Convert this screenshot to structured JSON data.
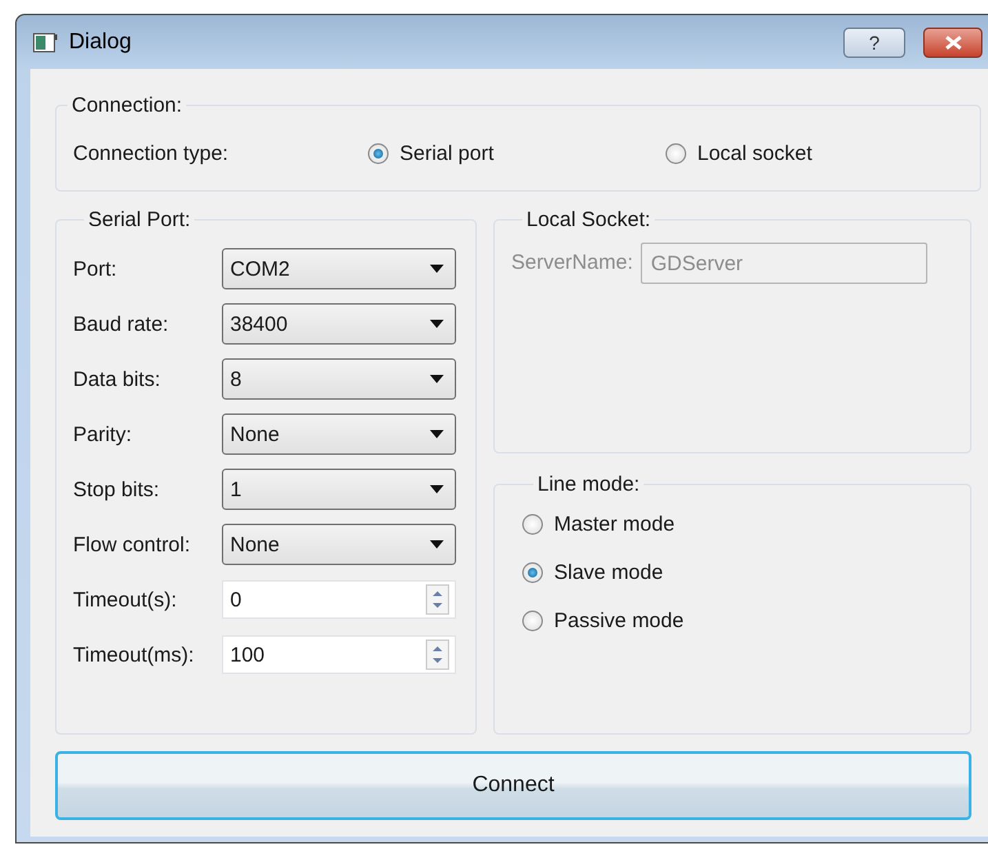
{
  "window": {
    "title": "Dialog",
    "help_button": "?"
  },
  "connection": {
    "title": "Connection:",
    "label": "Connection type:",
    "options": [
      {
        "label": "Serial port",
        "selected": true
      },
      {
        "label": "Local socket",
        "selected": false
      }
    ]
  },
  "serial_port": {
    "title": "Serial Port:",
    "rows": [
      {
        "kind": "combo",
        "label": "Port:",
        "value": "COM2"
      },
      {
        "kind": "combo",
        "label": "Baud rate:",
        "value": "38400"
      },
      {
        "kind": "combo",
        "label": "Data bits:",
        "value": "8"
      },
      {
        "kind": "combo",
        "label": "Parity:",
        "value": "None"
      },
      {
        "kind": "combo",
        "label": "Stop bits:",
        "value": "1"
      },
      {
        "kind": "combo",
        "label": "Flow control:",
        "value": "None"
      },
      {
        "kind": "spin",
        "label": "Timeout(s):",
        "value": "0"
      },
      {
        "kind": "spin",
        "label": "Timeout(ms):",
        "value": "100"
      }
    ]
  },
  "local_socket": {
    "title": "Local Socket:",
    "label": "ServerName:",
    "value": "GDServer",
    "disabled": true
  },
  "line_mode": {
    "title": "Line mode:",
    "options": [
      {
        "label": "Master mode",
        "selected": false
      },
      {
        "label": "Slave mode",
        "selected": true
      },
      {
        "label": "Passive mode",
        "selected": false
      }
    ]
  },
  "connect_button": "Connect"
}
